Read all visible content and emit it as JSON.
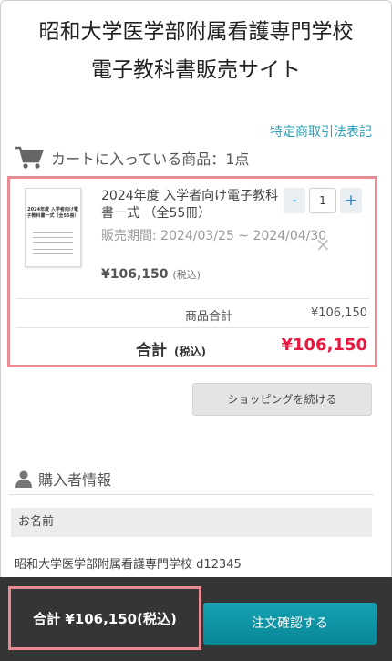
{
  "header": {
    "title_line1": "昭和大学医学部附属看護専門学校",
    "title_line2": "電子教科書販売サイト"
  },
  "legal_link": "特定商取引法表記",
  "cart": {
    "heading": "カートに入っている商品：1点",
    "item": {
      "thumb_title": "2024年度 入学者向け電子教科書一式（全55冊）",
      "name": "2024年度 入学者向け電子教科書一式 （全55冊）",
      "period": "販売期間: 2024/03/25 ~ 2024/04/30",
      "price": "¥106,150",
      "price_note": "(税込)",
      "quantity": "1",
      "minus": "-",
      "plus": "+",
      "remove": "×"
    },
    "subtotal_label": "商品合計",
    "subtotal_value": "¥106,150",
    "total_label": "合計",
    "total_note": "(税込)",
    "total_value": "¥106,150"
  },
  "continue_button": "ショッピングを続ける",
  "buyer": {
    "heading": "購入者情報",
    "name_label": "お名前",
    "name_value": "昭和大学医学部附属看護専門学校 d12345"
  },
  "footer": {
    "total_text": "合計 ¥106,150(税込)",
    "confirm_button": "注文確認する"
  },
  "colors": {
    "accent": "#13a1b2",
    "highlight_border": "#ea8a92",
    "total_red": "#e8173f"
  },
  "icons": {
    "cart": "cart-icon",
    "user": "user-icon"
  }
}
